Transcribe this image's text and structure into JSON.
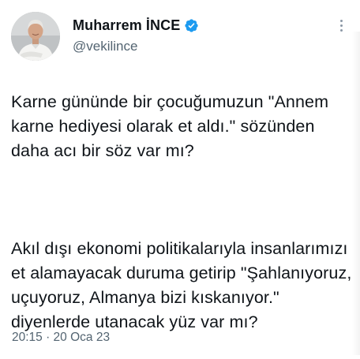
{
  "author": {
    "display_name": "Muharrem İNCE",
    "handle": "@vekilince",
    "verified": true,
    "avatar_icon": "profile-photo"
  },
  "tweet": {
    "paragraph_1": "Karne gününde bir çocuğumuzun \"Annem karne hediyesi olarak et aldı.\" sözünden daha acı bir söz var mı?",
    "paragraph_2": "Akıl dışı ekonomi politikalarıyla insanlarımızı et alamayacak duruma getirip \"Şahlanıyoruz, uçuyoruz, Almanya bizi kıskanıyor.\" diyenlerde utanacak yüz var mı?",
    "timestamp": "20:15 · 20 Oca 23"
  },
  "colors": {
    "text": "#0f1419",
    "secondary": "#536471",
    "verified_badge": "#1d9bf0",
    "background": "#ffffff"
  },
  "icons": {
    "verified": "verified-badge-icon",
    "more": "more-options-icon"
  }
}
